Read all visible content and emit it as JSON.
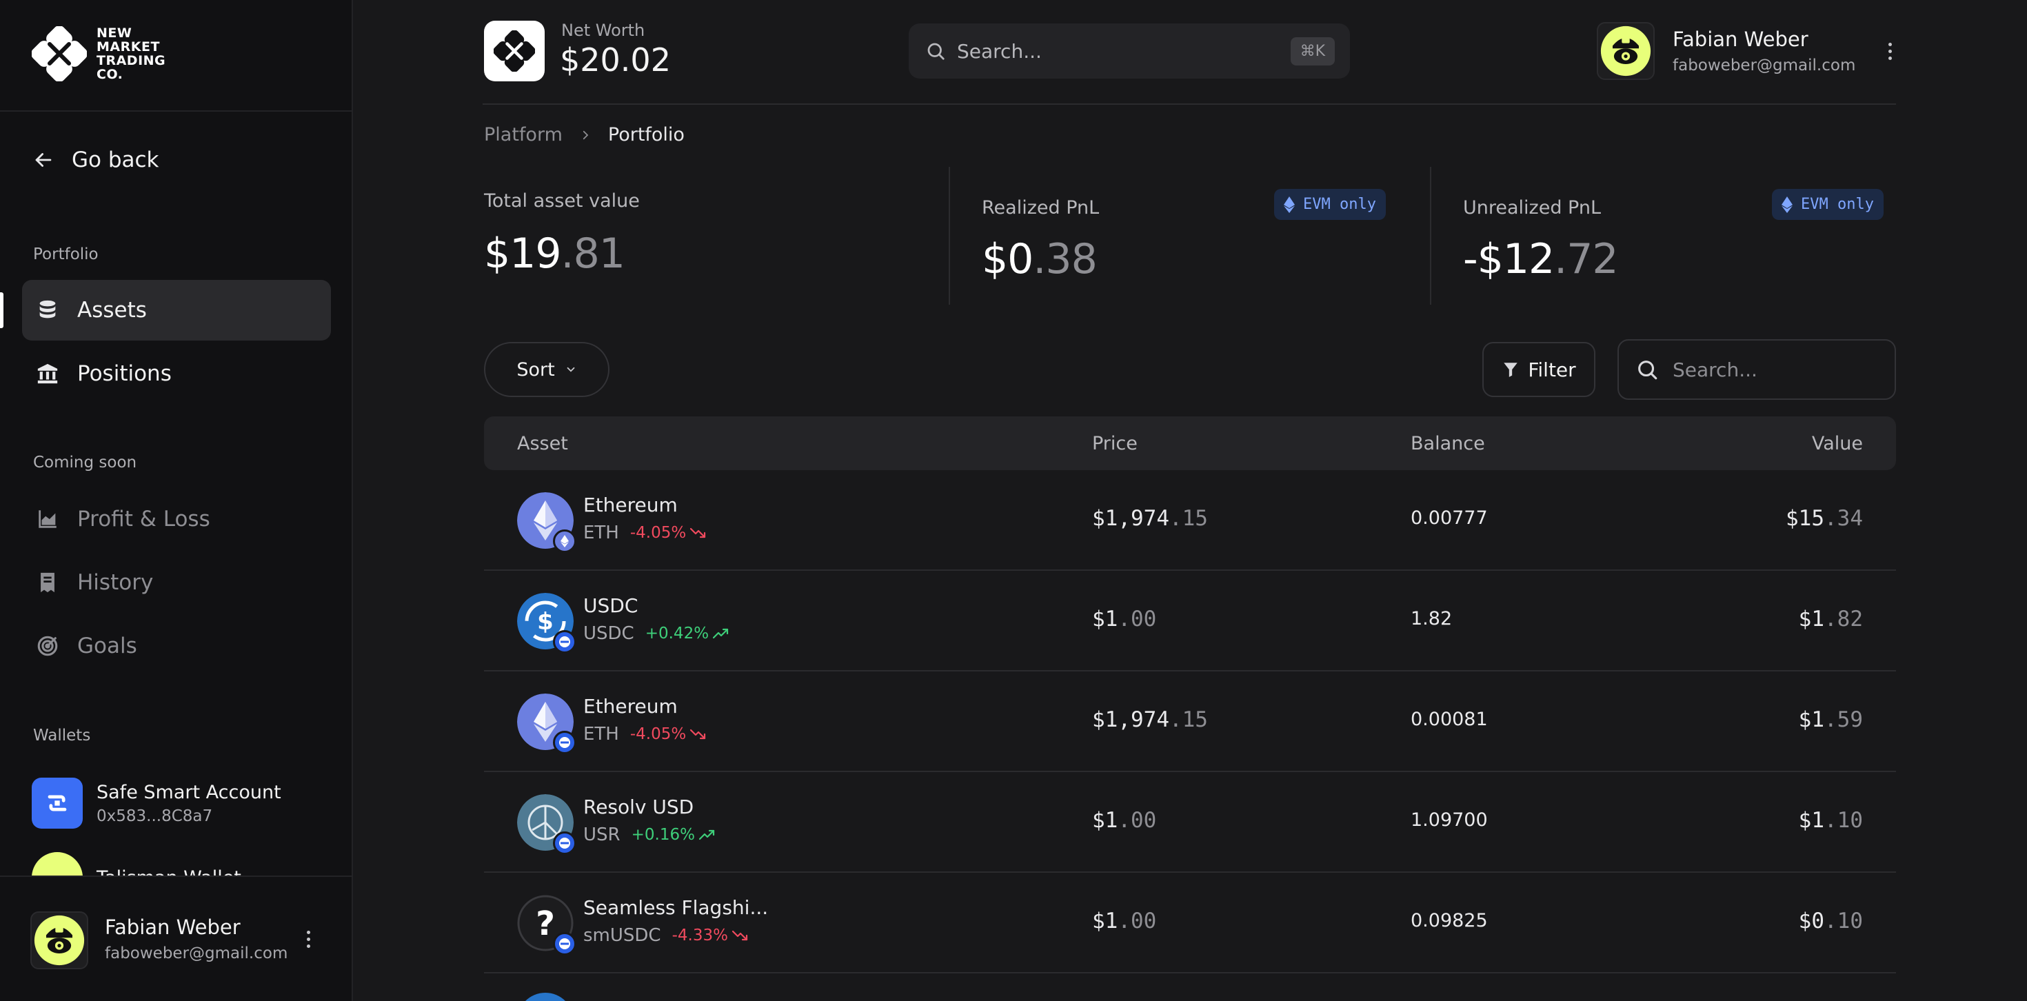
{
  "brand": {
    "logo_lines": [
      "NEW",
      "MARKET",
      "TRADING",
      "CO."
    ]
  },
  "sidebar": {
    "go_back": "Go back",
    "portfolio_label": "Portfolio",
    "portfolio_items": [
      {
        "label": "Assets",
        "icon": "database-icon",
        "active": true
      },
      {
        "label": "Positions",
        "icon": "bank-icon",
        "active": false
      }
    ],
    "coming_soon_label": "Coming soon",
    "coming_soon_items": [
      {
        "label": "Profit & Loss",
        "icon": "area-chart-icon"
      },
      {
        "label": "History",
        "icon": "receipt-icon"
      },
      {
        "label": "Goals",
        "icon": "target-icon"
      }
    ],
    "wallets_label": "Wallets",
    "wallets": [
      {
        "name": "Safe Smart Account",
        "address": "0x583...8C8a7"
      },
      {
        "name": "Talisman Wallet",
        "address": ""
      }
    ],
    "footer_user": {
      "name": "Fabian Weber",
      "email": "faboweber@gmail.com"
    }
  },
  "header": {
    "net_worth_label": "Net Worth",
    "net_worth_value": "$20.02",
    "search_placeholder": "Search...",
    "search_shortcut": "⌘K",
    "user": {
      "name": "Fabian Weber",
      "email": "faboweber@gmail.com"
    }
  },
  "breadcrumb": {
    "root": "Platform",
    "current": "Portfolio"
  },
  "stats": {
    "total": {
      "label": "Total asset value",
      "int": "$19",
      "dec": ".81"
    },
    "realized": {
      "label": "Realized PnL",
      "int": "$0",
      "dec": ".38",
      "badge": "EVM only"
    },
    "unrealized": {
      "label": "Unrealized PnL",
      "int": "-$12",
      "dec": ".72",
      "badge": "EVM only"
    }
  },
  "controls": {
    "sort_label": "Sort",
    "filter_label": "Filter",
    "search_placeholder": "Search..."
  },
  "table": {
    "headers": {
      "asset": "Asset",
      "price": "Price",
      "balance": "Balance",
      "value": "Value"
    },
    "rows": [
      {
        "name": "Ethereum",
        "symbol": "ETH",
        "change": "-4.05%",
        "dir": "down",
        "icon": "eth",
        "chain": "eth",
        "price_int": "$1,974",
        "price_dec": ".15",
        "balance": "0.00777",
        "value_int": "$15",
        "value_dec": ".34"
      },
      {
        "name": "USDC",
        "symbol": "USDC",
        "change": "+0.42%",
        "dir": "up",
        "icon": "usdc",
        "chain": "base",
        "price_int": "$1",
        "price_dec": ".00",
        "balance": "1.82",
        "value_int": "$1",
        "value_dec": ".82"
      },
      {
        "name": "Ethereum",
        "symbol": "ETH",
        "change": "-4.05%",
        "dir": "down",
        "icon": "eth",
        "chain": "base",
        "price_int": "$1,974",
        "price_dec": ".15",
        "balance": "0.00081",
        "value_int": "$1",
        "value_dec": ".59"
      },
      {
        "name": "Resolv USD",
        "symbol": "USR",
        "change": "+0.16%",
        "dir": "up",
        "icon": "resolv",
        "chain": "base",
        "price_int": "$1",
        "price_dec": ".00",
        "balance": "1.09700",
        "value_int": "$1",
        "value_dec": ".10"
      },
      {
        "name": "Seamless Flagshi...",
        "symbol": "smUSDC",
        "change": "-4.33%",
        "dir": "down",
        "icon": "unknown",
        "chain": "base",
        "price_int": "$1",
        "price_dec": ".00",
        "balance": "0.09825",
        "value_int": "$0",
        "value_dec": ".10"
      }
    ]
  },
  "colors": {
    "positive": "#3ecf7a",
    "negative": "#f04a5e",
    "evm_badge": "#7fa6ff",
    "avatar_bg": "#e8ff7a"
  }
}
